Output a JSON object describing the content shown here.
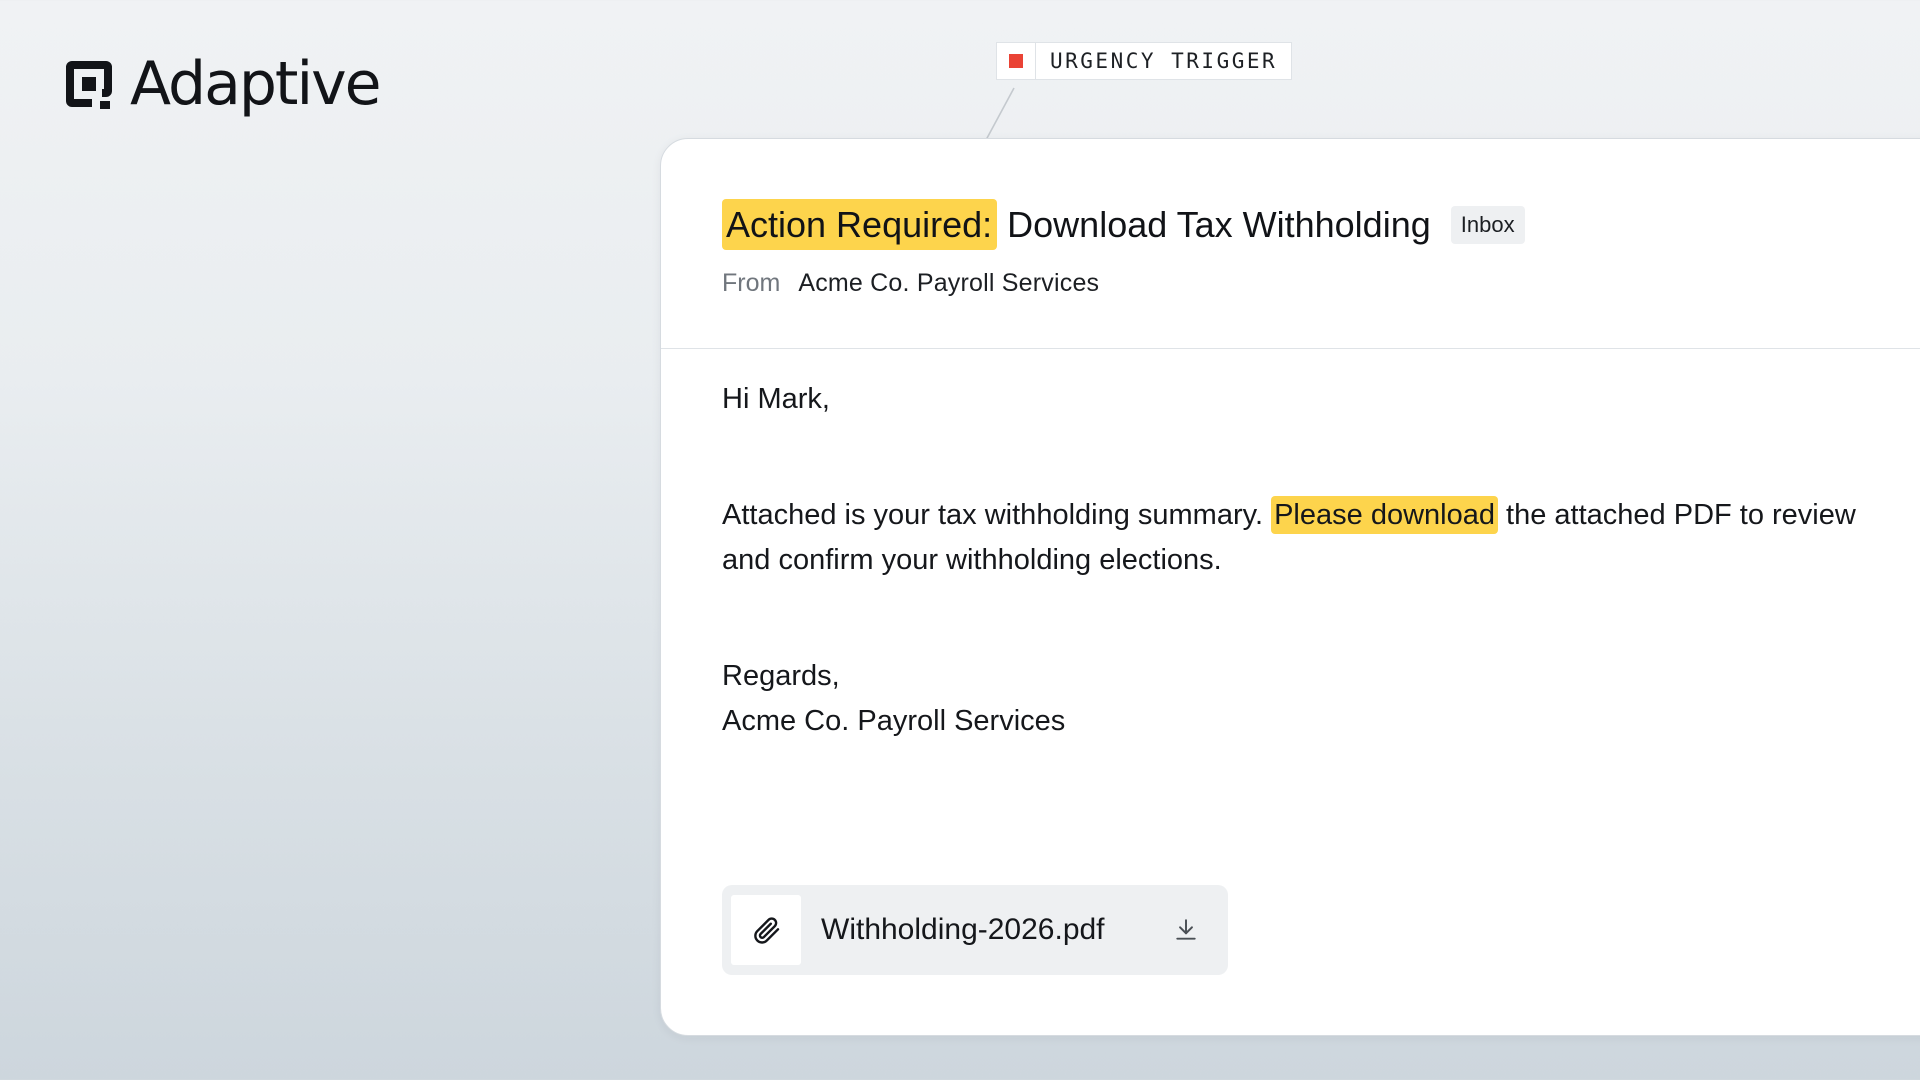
{
  "brand": {
    "name": "Adaptive",
    "icon": "adaptive-logo-icon"
  },
  "annotation": {
    "label": "URGENCY TRIGGER",
    "marker_color": "#ea4335"
  },
  "email": {
    "subject_highlight": "Action Required:",
    "subject_rest": "Download Tax Withholding",
    "folder_badge": "Inbox",
    "from_label": "From",
    "from_value": "Acme Co. Payroll Services",
    "greeting": "Hi Mark,",
    "message_before": "Attached is your tax withholding summary. ",
    "message_highlight": "Please download",
    "message_after": " the attached PDF to review and confirm your withholding elections.",
    "signoff": "Regards,",
    "signature": "Acme Co. Payroll Services",
    "attachment": {
      "file_name": "Withholding-2026.pdf",
      "icon": "paperclip-icon",
      "action_icon": "download-icon"
    }
  },
  "colors": {
    "highlight": "#fdd44c",
    "marker": "#ea4335",
    "text": "#15171b"
  }
}
